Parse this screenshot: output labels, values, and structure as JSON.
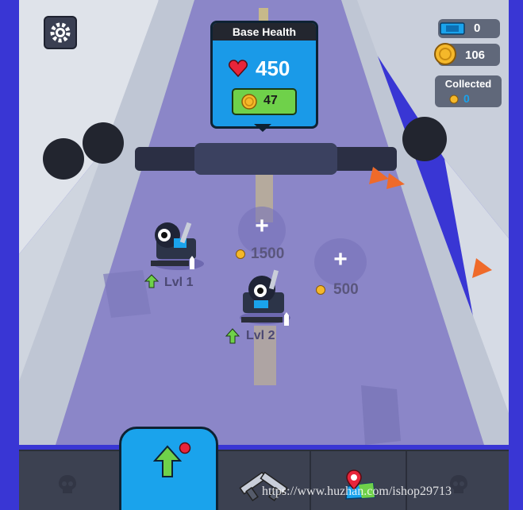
{
  "hud": {
    "base_health_title": "Base Health",
    "base_health_value": "450",
    "base_repair_cost": "47",
    "tickets_count": "0",
    "coins_count": "106",
    "collected_label": "Collected",
    "collected_value": "0"
  },
  "build_spots": [
    {
      "cost": "1500"
    },
    {
      "cost": "500"
    }
  ],
  "units": [
    {
      "level_label": "Lvl 1"
    },
    {
      "level_label": "Lvl 2"
    }
  ],
  "watermark": "https://www.huzhan.com/ishop29713",
  "colors": {
    "accent_blue": "#1aa3ec",
    "road": "#8b86c8",
    "coin_gold": "#f5b82a",
    "health_red": "#e8253a",
    "cost_green": "#6fd14a"
  }
}
